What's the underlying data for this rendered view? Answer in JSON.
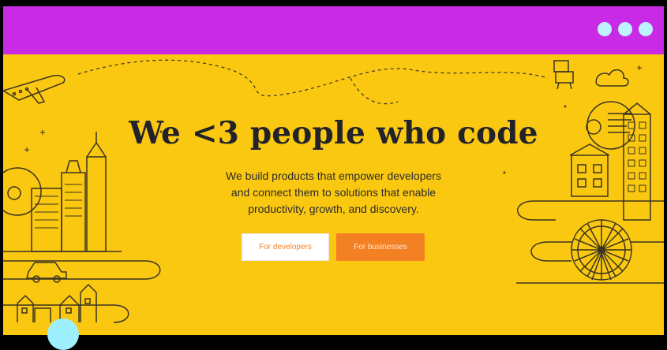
{
  "hero": {
    "headline": "We <3 people who code",
    "subtitle_lines": [
      "We build products that empower developers",
      "and connect them to solutions that enable",
      "productivity, growth, and discovery."
    ],
    "button_developers": "For developers",
    "button_businesses": "For businesses"
  },
  "colors": {
    "top_bar": "#c92ae6",
    "background": "#fbc811",
    "accent": "#f48024",
    "dots": "#bdf3ff"
  },
  "icons": [
    "more-options-icon",
    "airplane-icon",
    "robot-icon",
    "cloud-icon",
    "city-buildings-icon",
    "car-icon",
    "houses-icon",
    "ferris-wheel-icon",
    "office-building-icon",
    "chart-bubble-icon"
  ]
}
